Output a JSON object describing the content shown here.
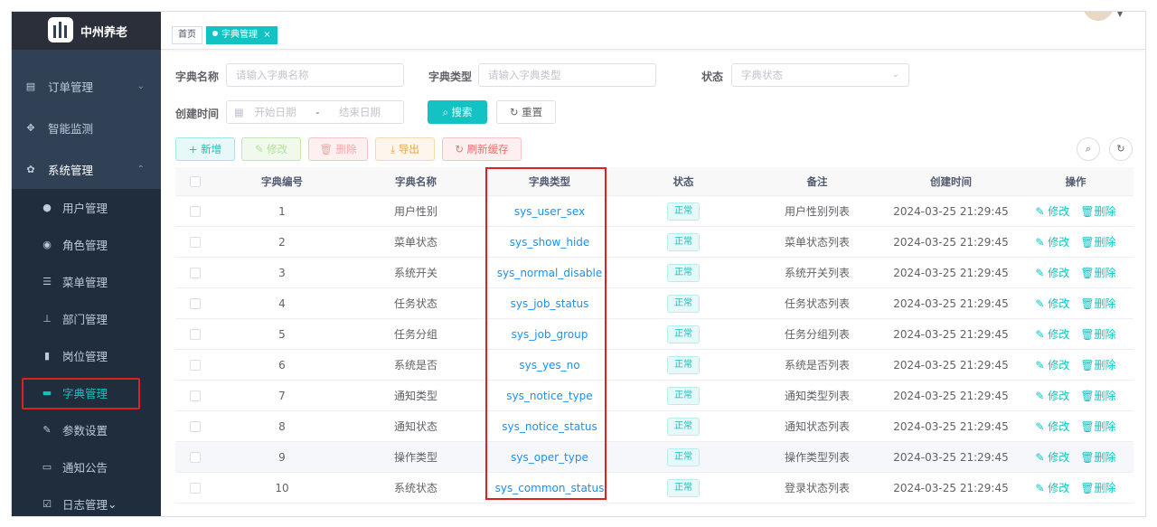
{
  "app": {
    "title": "中州养老"
  },
  "sidebar": {
    "items": [
      {
        "label": "订单管理",
        "icon": "order-icon",
        "expandable": true
      },
      {
        "label": "智能监测",
        "icon": "monitor-icon",
        "expandable": false
      },
      {
        "label": "系统管理",
        "icon": "gear-icon",
        "expandable": true
      }
    ],
    "submenu": [
      {
        "label": "用户管理",
        "icon": "user-icon"
      },
      {
        "label": "角色管理",
        "icon": "role-icon"
      },
      {
        "label": "菜单管理",
        "icon": "menu-tree-icon"
      },
      {
        "label": "部门管理",
        "icon": "org-icon"
      },
      {
        "label": "岗位管理",
        "icon": "post-icon"
      },
      {
        "label": "字典管理",
        "icon": "dict-icon"
      },
      {
        "label": "参数设置",
        "icon": "edit-icon"
      },
      {
        "label": "通知公告",
        "icon": "message-icon"
      }
    ],
    "bottom_item": {
      "label": "日志管理",
      "icon": "log-icon"
    }
  },
  "tags": [
    {
      "label": "首页",
      "active": false
    },
    {
      "label": "字典管理",
      "active": true,
      "close": "×"
    }
  ],
  "search": {
    "name_label": "字典名称",
    "name_placeholder": "请输入字典名称",
    "type_label": "字典类型",
    "type_placeholder": "请输入字典类型",
    "status_label": "状态",
    "status_placeholder": "字典状态",
    "created_label": "创建时间",
    "start_placeholder": "开始日期",
    "range_sep": "-",
    "end_placeholder": "结束日期",
    "search_btn": "搜索",
    "reset_btn": "重置"
  },
  "toolbar": {
    "add": "新增",
    "edit": "修改",
    "delete": "删除",
    "export": "导出",
    "refresh_cache": "刷新缓存"
  },
  "table": {
    "columns": [
      "字典编号",
      "字典名称",
      "字典类型",
      "状态",
      "备注",
      "创建时间",
      "操作"
    ],
    "edit_label": "修改",
    "delete_label": "删除",
    "rows": [
      {
        "id": "1",
        "name": "用户性别",
        "type": "sys_user_sex",
        "status": "正常",
        "remark": "用户性别列表",
        "created": "2024-03-25 21:29:45"
      },
      {
        "id": "2",
        "name": "菜单状态",
        "type": "sys_show_hide",
        "status": "正常",
        "remark": "菜单状态列表",
        "created": "2024-03-25 21:29:45"
      },
      {
        "id": "3",
        "name": "系统开关",
        "type": "sys_normal_disable",
        "status": "正常",
        "remark": "系统开关列表",
        "created": "2024-03-25 21:29:45"
      },
      {
        "id": "4",
        "name": "任务状态",
        "type": "sys_job_status",
        "status": "正常",
        "remark": "任务状态列表",
        "created": "2024-03-25 21:29:45"
      },
      {
        "id": "5",
        "name": "任务分组",
        "type": "sys_job_group",
        "status": "正常",
        "remark": "任务分组列表",
        "created": "2024-03-25 21:29:45"
      },
      {
        "id": "6",
        "name": "系统是否",
        "type": "sys_yes_no",
        "status": "正常",
        "remark": "系统是否列表",
        "created": "2024-03-25 21:29:45"
      },
      {
        "id": "7",
        "name": "通知类型",
        "type": "sys_notice_type",
        "status": "正常",
        "remark": "通知类型列表",
        "created": "2024-03-25 21:29:45"
      },
      {
        "id": "8",
        "name": "通知状态",
        "type": "sys_notice_status",
        "status": "正常",
        "remark": "通知状态列表",
        "created": "2024-03-25 21:29:45"
      },
      {
        "id": "9",
        "name": "操作类型",
        "type": "sys_oper_type",
        "status": "正常",
        "remark": "操作类型列表",
        "created": "2024-03-25 21:29:45"
      },
      {
        "id": "10",
        "name": "系统状态",
        "type": "sys_common_status",
        "status": "正常",
        "remark": "登录状态列表",
        "created": "2024-03-25 21:29:45"
      }
    ]
  },
  "colors": {
    "accent": "#13c2c2",
    "sidebar_bg": "#304156",
    "annotation": "#e02020"
  }
}
